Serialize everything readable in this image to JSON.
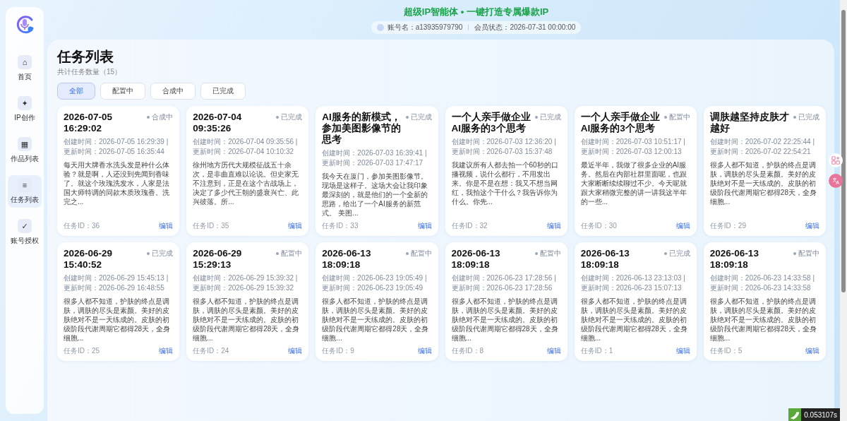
{
  "header": {
    "title": "超级IP智能体 • 一键打造专属爆款IP",
    "account": "账号名：a13935979790",
    "membership": "会员状态：2026-07-31 00:00:00"
  },
  "sidebar": {
    "items": [
      {
        "icon": "⌂",
        "label": "首页",
        "selected": false
      },
      {
        "icon": "✦",
        "label": "IP创作",
        "selected": false
      },
      {
        "icon": "▦",
        "label": "作品列表",
        "selected": false
      },
      {
        "icon": "≡",
        "label": "任务列表",
        "selected": true
      },
      {
        "icon": "✓",
        "label": "账号授权",
        "selected": false
      }
    ]
  },
  "page": {
    "title": "任务列表",
    "subtitle": "共计任务数量（15）"
  },
  "filters": [
    {
      "label": "全部",
      "selected": true
    },
    {
      "label": "配置中",
      "selected": false
    },
    {
      "label": "合成中",
      "selected": false
    },
    {
      "label": "已完成",
      "selected": false
    }
  ],
  "tasks": [
    {
      "title": "2026-07-05 16:29:02",
      "status": "合成中",
      "created": "创建时间：2026-07-05 16:29:39 |",
      "updated": "更新时间：2026-07-05 16:35:44",
      "summary": "每天用大牌香水洗头发是种什么体验？就是啊，人还没到先闻到香味了。就这个玫瑰洗发水，人家是法国大师特调的同款木质玫瑰香。洗完之...",
      "id": "任务ID：36",
      "edit": "编辑"
    },
    {
      "title": "2026-07-04 09:35:26",
      "status": "已完成",
      "created": "创建时间：2026-07-04 09:35:56 |",
      "updated": "更新时间：2026-07-04 10:10:32",
      "summary": "徐州地方历代大规模征战五十余次，是非曲直难以论说。但史家无不注意到，正是在这个古战场上，决定了多少代王朝的盛衰兴亡、此兴彼落。所...",
      "id": "任务ID：35",
      "edit": "编辑"
    },
    {
      "title": "AI服务的新模式，参加美图影像节的思考",
      "status": "已完成",
      "created": "创建时间：2026-07-03 16:39:41 |",
      "updated": "更新时间：2026-07-03 17:47:17",
      "summary": "我今天在厦门，参加美图影像节。现场是这样子。这场大会让我印象最深刻的，就是他们的一个全新的思路，给出了一个AI服务的新范式。 美图...",
      "id": "任务ID：33",
      "edit": "编辑"
    },
    {
      "title": "一个人亲手做企业AI服务的3个思考",
      "status": "已完成",
      "created": "创建时间：2026-07-03 12:36:20 |",
      "updated": "更新时间：2026-07-03 15:37:48",
      "summary": "我建议所有人都去拍一个60秒的口播视频，说什么都行，不用发出来。你是不是在想：我又不想当网红，我拍这个干什么？我告诉你为什么。你先...",
      "id": "任务ID：32",
      "edit": "编辑"
    },
    {
      "title": "一个人亲手做企业AI服务的3个思考",
      "status": "配置中",
      "created": "创建时间：2026-07-03 10:51:17 |",
      "updated": "更新时间：2026-07-03 12:00:13",
      "summary": "最近半年，我做了很多企业的AI服务。然后在内部社群里面呢，也跟大家断断续续聊过不少。今天呢就跟大家稍微完整的讲一讲我这半年的一些...",
      "id": "任务ID：30",
      "edit": "编辑"
    },
    {
      "title": "调肤越坚持皮肤才越好",
      "status": "已完成",
      "created": "创建时间：2026-07-02 22:25:44 |",
      "updated": "更新时间：2026-07-02 22:54:21",
      "summary": "很多人都不知道，护肤的终点是调肤，调肤的尽头是素颜。美好的皮肤绝对不是一天练成的。皮肤的初级阶段代谢周期它都得28天，全身细胞...",
      "id": "任务ID：29",
      "edit": "编辑"
    },
    {
      "title": "2026-06-29 15:40:52",
      "status": "已完成",
      "created": "创建时间：2026-06-29 15:45:13 |",
      "updated": "更新时间：2026-06-29 16:48:55",
      "summary": "很多人都不知道，护肤的终点是调肤，调肤的尽头是素颜。美好的皮肤绝对不是一天练成的。皮肤的初级阶段代谢周期它都得28天，全身细胞...",
      "id": "任务ID：25",
      "edit": "编辑"
    },
    {
      "title": "2026-06-29 15:29:13",
      "status": "配置中",
      "created": "创建时间：2026-06-29 15:39:32 |",
      "updated": "更新时间：2026-06-29 15:39:32",
      "summary": "很多人都不知道，护肤的终点是调肤，调肤的尽头是素颜。美好的皮肤绝对不是一天练成的。皮肤的初级阶段代谢周期它都得28天，全身细胞...",
      "id": "任务ID：24",
      "edit": "编辑"
    },
    {
      "title": "2026-06-13 18:09:18",
      "status": "配置中",
      "created": "创建时间：2026-06-23 19:05:49 |",
      "updated": "更新时间：2026-06-23 19:05:49",
      "summary": "很多人都不知道，护肤的终点是调肤，调肤的尽头是素颜。美好的皮肤绝对不是一天练成的。皮肤的初级阶段代谢周期它都得28天，全身细胞...",
      "id": "任务ID：9",
      "edit": "编辑"
    },
    {
      "title": "2026-06-13 18:09:18",
      "status": "配置中",
      "created": "创建时间：2026-06-23 17:28:56 |",
      "updated": "更新时间：2026-06-23 17:28:56",
      "summary": "很多人都不知道，护肤的终点是调肤，调肤的尽头是素颜。美好的皮肤绝对不是一天练成的。皮肤的初级阶段代谢周期它都得28天，全身细胞...",
      "id": "任务ID：8",
      "edit": "编辑"
    },
    {
      "title": "2026-06-13 18:09:18",
      "status": "已完成",
      "created": "创建时间：2026-06-13 23:13:03 |",
      "updated": "更新时间：2026-06-23 15:07:13",
      "summary": "很多人都不知道，护肤的终点是调肤，调肤的尽头是素颜。美好的皮肤绝对不是一天练成的。皮肤的初级阶段代谢周期它都得28天，全身细胞...",
      "id": "任务ID：1",
      "edit": "编辑"
    },
    {
      "title": "2026-06-13 18:09:18",
      "status": "配置中",
      "created": "创建时间：2026-06-23 14:33:58 |",
      "updated": "更新时间：2026-06-23 14:33:58",
      "summary": "很多人都不知道，护肤的终点是调肤，调肤的尽头是素颜。美好的皮肤绝对不是一天练成的。皮肤的初级阶段代谢周期它都得28天，全身细胞...",
      "id": "任务ID：5",
      "edit": "编辑"
    }
  ],
  "timer": "0.053107s"
}
